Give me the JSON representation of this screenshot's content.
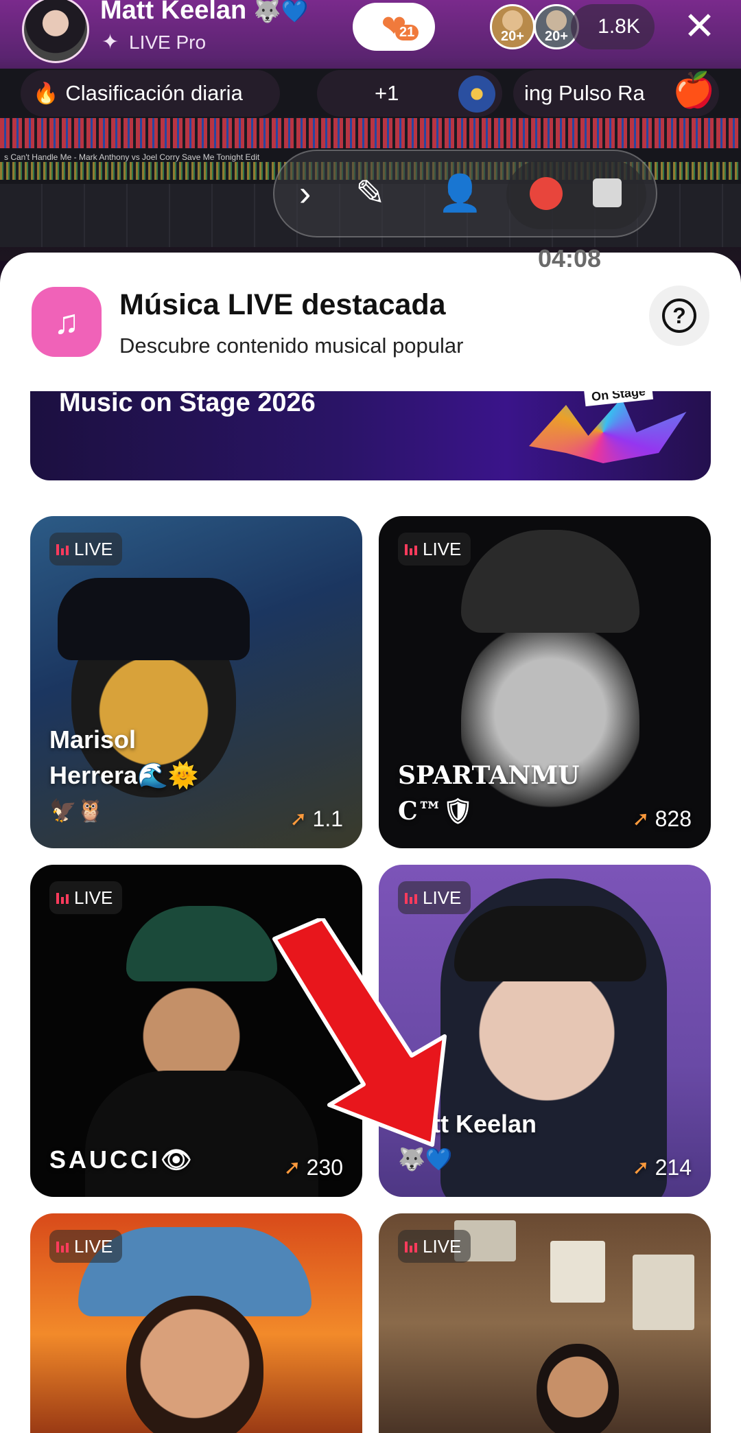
{
  "host": {
    "name": "Matt Keelan",
    "name_emoji": "🐺💙",
    "badge": "LIVE Pro"
  },
  "hearts": {
    "count": "21"
  },
  "viewers": {
    "avatar_badges": [
      "20+",
      "20+"
    ],
    "count": "1.8K"
  },
  "stream_bar": {
    "ranking_label": "Clasificación diaria",
    "plus_label": "+1",
    "pulse_label": "ing Pulso   Ra",
    "dj_track_text": "s Can't Handle Me - Mark Anthony vs Joel Corry Save Me Tonight Edit"
  },
  "recorder": {
    "timer": "04:08"
  },
  "sheet": {
    "title": "Música LIVE destacada",
    "subtitle": "Descubre contenido musical popular",
    "help_icon": "?"
  },
  "banner": {
    "title": "Music on Stage 2026",
    "tag": "On Stage"
  },
  "cards": [
    {
      "live": "LIVE",
      "name_line1": "Marisol",
      "name_line2": "Herrera🌊🌞",
      "emoji_line": "🦅🦉",
      "count": "1.1"
    },
    {
      "live": "LIVE",
      "name_line1": "SPARTANMU",
      "name_line2": "C™🛡",
      "emoji_line": "",
      "count": "828"
    },
    {
      "live": "LIVE",
      "name_line1": "SAUCCI👁",
      "name_line2": "",
      "emoji_line": "",
      "count": "230"
    },
    {
      "live": "LIVE",
      "name_line1": "Matt Keelan",
      "name_line2": "",
      "emoji_line": "🐺💙",
      "count": "214"
    },
    {
      "live": "LIVE",
      "name_line1": "",
      "name_line2": "",
      "emoji_line": "",
      "count": ""
    },
    {
      "live": "LIVE",
      "name_line1": "",
      "name_line2": "",
      "emoji_line": "",
      "count": ""
    }
  ],
  "colors": {
    "accent_pink": "#f062b8",
    "live_red": "#ff3b5c",
    "record_red": "#e8453c",
    "hearts_orange": "#f07a3c"
  },
  "icons": {
    "close": "close-icon",
    "fire": "fire-icon",
    "sparkle": "sparkle-icon",
    "next": "chevron-right-icon",
    "pen": "pen-icon",
    "user": "user-icon",
    "record": "record-icon",
    "stop": "stop-icon",
    "music_badge": "music-note-icon",
    "help": "help-icon",
    "trend": "trend-icon",
    "annotation_arrow": "red-arrow-icon"
  }
}
